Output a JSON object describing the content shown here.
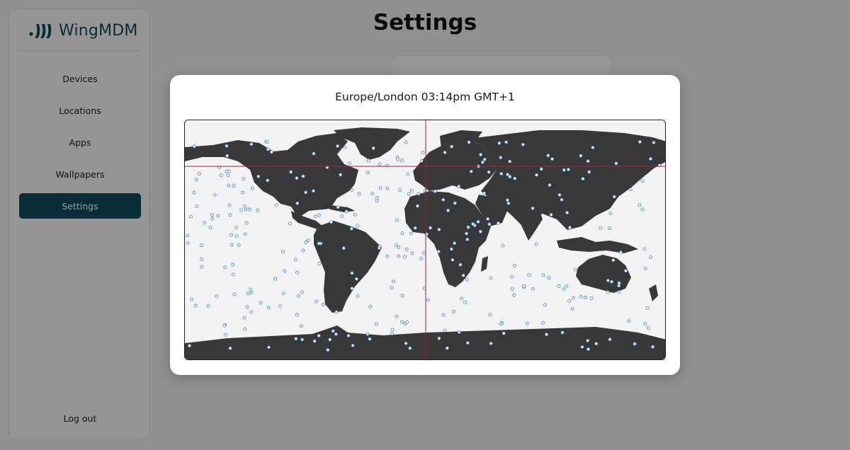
{
  "brand": {
    "name": "WingMDM"
  },
  "sidebar": {
    "items": [
      {
        "label": "Devices",
        "active": false
      },
      {
        "label": "Locations",
        "active": false
      },
      {
        "label": "Apps",
        "active": false
      },
      {
        "label": "Wallpapers",
        "active": false
      },
      {
        "label": "Settings",
        "active": true
      }
    ],
    "logout_label": "Log out"
  },
  "main": {
    "title": "Settings"
  },
  "modal": {
    "title": "Europe/London 03:14pm GMT+1"
  },
  "map": {
    "selected_timezone": "Europe/London",
    "selected_longitude": 0,
    "selected_latitude": 51.5
  },
  "colors": {
    "accent": "#0f4b5c",
    "land": "#383838",
    "ocean": "#f3f3f3",
    "marker": "#4a90d9",
    "crosshair": "#c8103c"
  }
}
